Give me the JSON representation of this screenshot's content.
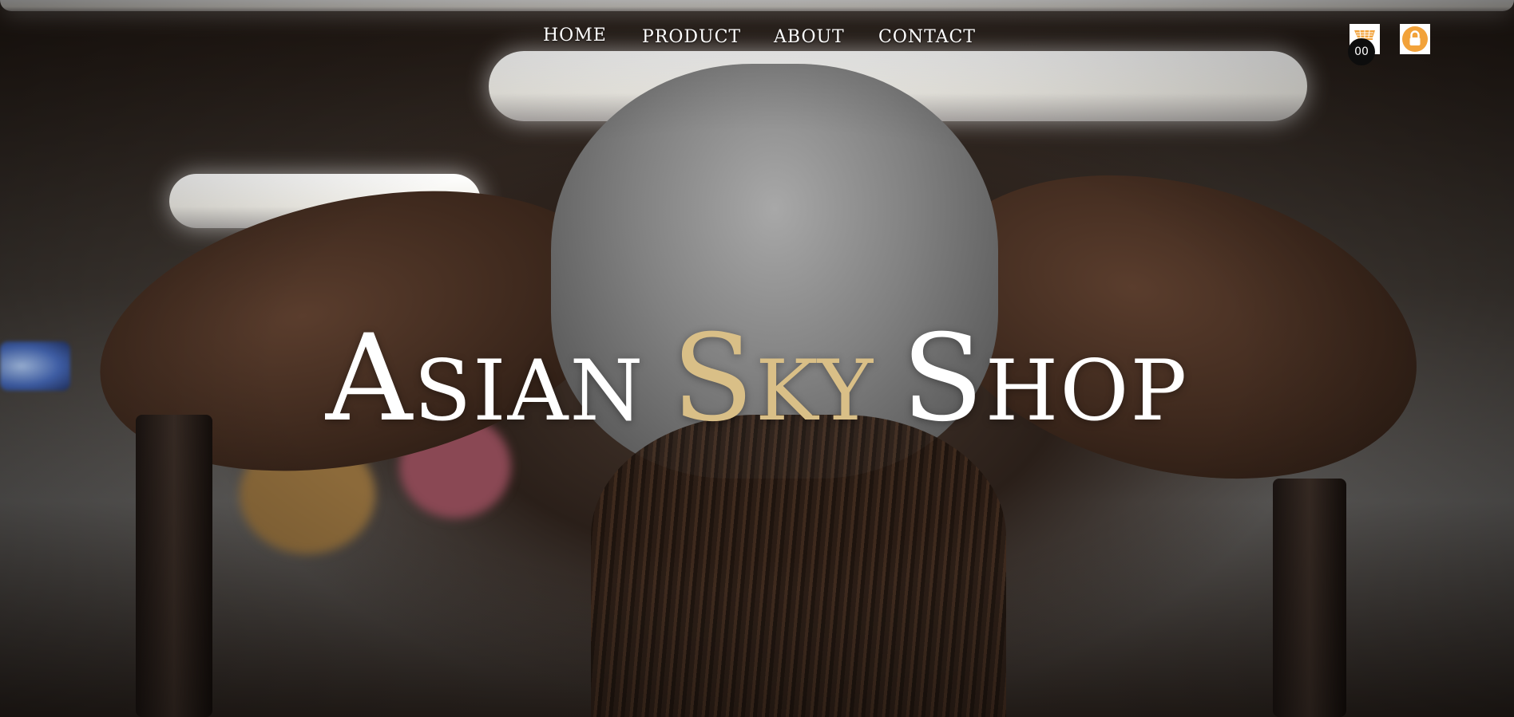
{
  "nav": {
    "home": "HOME",
    "product": "PRODUCT",
    "about": "ABOUT",
    "contact": "CONTACT"
  },
  "cart": {
    "count": "00",
    "icon": "shopping-cart-icon"
  },
  "account": {
    "icon": "user-account-icon"
  },
  "hero": {
    "title_part1": "Asian",
    "title_part2": "Sky",
    "title_part3": "Shop"
  },
  "colors": {
    "accent_gold": "#d9bf87",
    "account_orange": "#f2a23a",
    "text_white": "#ffffff"
  }
}
